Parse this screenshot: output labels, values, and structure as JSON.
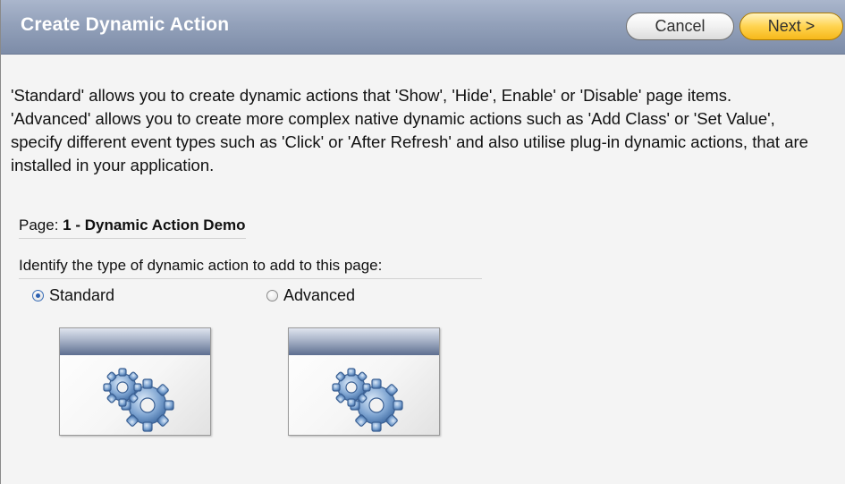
{
  "header": {
    "title": "Create Dynamic Action",
    "cancel_label": "Cancel",
    "next_label": "Next >"
  },
  "description": "'Standard' allows you to create dynamic actions that 'Show', 'Hide', Enable' or 'Disable' page items. 'Advanced' allows you to create more complex native dynamic actions such as 'Add Class' or 'Set Value', specify different event types such as 'Click' or 'After Refresh' and also utilise plug-in dynamic actions, that are installed in your application.",
  "page_info": {
    "label": "Page:",
    "value": "1 - Dynamic Action Demo"
  },
  "question": "Identify the type of dynamic action to add to this page:",
  "options": [
    {
      "label": "Standard",
      "selected": true,
      "icon": "gears-icon"
    },
    {
      "label": "Advanced",
      "selected": false,
      "icon": "gears-icon"
    }
  ],
  "colors": {
    "header": "#8d9bb6",
    "next_button": "#ffc72a",
    "radio_selected": "#2b5fb0"
  }
}
